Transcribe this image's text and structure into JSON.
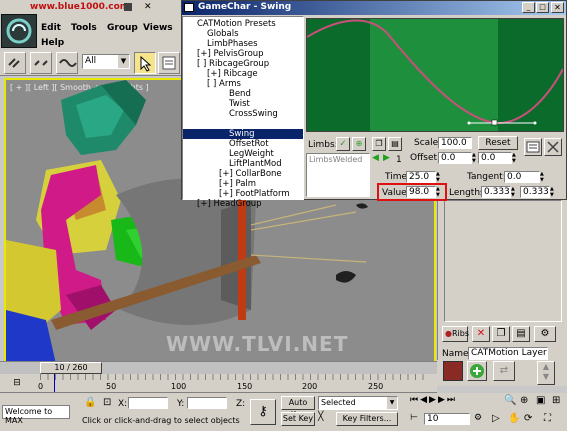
{
  "watermark_top": "www.blue1000.com",
  "menu": {
    "edit": "Edit",
    "tools": "Tools",
    "group": "Group",
    "views": "Views",
    "help": "Help"
  },
  "toolbar": {
    "filter_value": "All"
  },
  "viewport": {
    "label": "[ + ][ Left ][ Smooth + Highlights ]",
    "watermark": "WWW.TLVI.NET"
  },
  "dialog": {
    "title": "GameChar - Swing",
    "tree": [
      "CATMotion Presets",
      "Globals",
      "LimbPhases",
      "[+] PelvisGroup",
      "[ ] RibcageGroup",
      "[+] Ribcage",
      "[ ] Arms",
      "Bend",
      "Twist",
      "CrossSwing",
      "Swing",
      "OffsetRot",
      "LegWeight",
      "LiftPlantMod",
      "[+] CollarBone",
      "[+] Palm",
      "[+] FootPlatform",
      "[+] HeadGroup"
    ],
    "limbs_label": "Limbs:",
    "limbs_list": "LimbsWelded",
    "limbs_counter": "1",
    "scale_label": "Scale:",
    "scale_value": "100.0",
    "reset_label": "Reset",
    "offset_label": "Offset:",
    "offset_value1": "0.0",
    "offset_value2": "0.0",
    "time_label": "Time:",
    "time_value": "25.0",
    "tangent_label": "Tangent:",
    "tangent_value": "0.0",
    "value_label": "Value:",
    "value_value": "98.0",
    "lengths_label": "Lengths:",
    "lengths_value1": "0.333",
    "lengths_value2": "0.333"
  },
  "right_panel": {
    "ribs_label": "Ribs",
    "name_label": "Name:",
    "name_value": "CATMotion Layer"
  },
  "timeline": {
    "frame_counter": "10 / 260",
    "ticks": [
      "0",
      "50",
      "100",
      "150",
      "200",
      "250"
    ]
  },
  "status": {
    "welcome": "Welcome to MAX",
    "x_label": "X:",
    "y_label": "Y:",
    "z_label": "Z:",
    "prompt": "Click or click-and-drag to select objects",
    "auto_key": "Auto Key",
    "selected": "Selected",
    "set_key": "Set Key",
    "key_filters": "Key Filters...",
    "frame": "10"
  },
  "colors": {
    "curve_bg": "#0b6b2a",
    "curve_band": "#1e8f3d",
    "curve_line": "#c8507a",
    "highlight_box": "#e01010"
  }
}
